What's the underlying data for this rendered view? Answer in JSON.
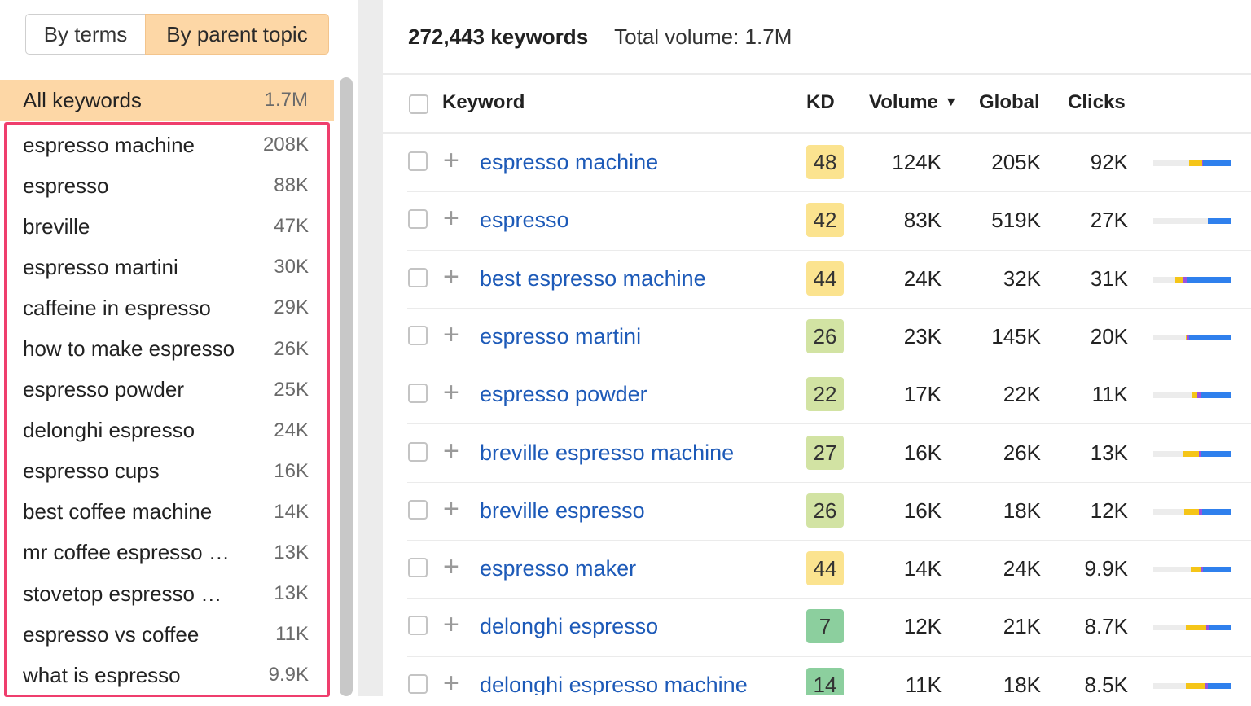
{
  "toggle": {
    "by_terms": "By terms",
    "by_parent_topic": "By parent topic"
  },
  "all_keywords": {
    "label": "All keywords",
    "volume": "1.7M"
  },
  "topics": [
    {
      "name": "espresso machine",
      "volume": "208K"
    },
    {
      "name": "espresso",
      "volume": "88K"
    },
    {
      "name": "breville",
      "volume": "47K"
    },
    {
      "name": "espresso martini",
      "volume": "30K"
    },
    {
      "name": "caffeine in espresso",
      "volume": "29K"
    },
    {
      "name": "how to make espresso",
      "volume": "26K"
    },
    {
      "name": "espresso powder",
      "volume": "25K"
    },
    {
      "name": "delonghi espresso",
      "volume": "24K"
    },
    {
      "name": "espresso cups",
      "volume": "16K"
    },
    {
      "name": "best coffee machine",
      "volume": "14K"
    },
    {
      "name": "mr coffee espresso …",
      "volume": "13K"
    },
    {
      "name": "stovetop espresso …",
      "volume": "13K"
    },
    {
      "name": "espresso vs coffee",
      "volume": "11K"
    },
    {
      "name": "what is espresso",
      "volume": "9.9K"
    }
  ],
  "header": {
    "count": "272,443 keywords",
    "total_volume": "Total volume: 1.7M"
  },
  "columns": {
    "keyword": "Keyword",
    "kd": "KD",
    "volume": "Volume",
    "global": "Global",
    "clicks": "Clicks"
  },
  "colors": {
    "kd_yellow": "#fbe38f",
    "kd_lightgreen": "#d2e3a3",
    "kd_green": "#8ccf9e",
    "accent": "#fdd7a6",
    "highlight_border": "#ef3e6d",
    "link": "#1d5ab8"
  },
  "rows": [
    {
      "keyword": "espresso machine",
      "kd": "48",
      "kd_color": "#fbe38f",
      "volume": "124K",
      "global": "205K",
      "clicks": "92K",
      "click_split": [
        0.46,
        0.16,
        0.02,
        0.36
      ]
    },
    {
      "keyword": "espresso",
      "kd": "42",
      "kd_color": "#fbe38f",
      "volume": "83K",
      "global": "519K",
      "clicks": "27K",
      "click_split": [
        0.7,
        0,
        0,
        0.3
      ]
    },
    {
      "keyword": "best espresso machine",
      "kd": "44",
      "kd_color": "#fbe38f",
      "volume": "24K",
      "global": "32K",
      "clicks": "31K",
      "click_split": [
        0.28,
        0.1,
        0.06,
        0.56
      ]
    },
    {
      "keyword": "espresso martini",
      "kd": "26",
      "kd_color": "#d2e3a3",
      "volume": "23K",
      "global": "145K",
      "clicks": "20K",
      "click_split": [
        0.42,
        0.02,
        0.02,
        0.54
      ]
    },
    {
      "keyword": "espresso powder",
      "kd": "22",
      "kd_color": "#d2e3a3",
      "volume": "17K",
      "global": "22K",
      "clicks": "11K",
      "click_split": [
        0.5,
        0.06,
        0.04,
        0.4
      ]
    },
    {
      "keyword": "breville espresso machine",
      "kd": "27",
      "kd_color": "#d2e3a3",
      "volume": "16K",
      "global": "26K",
      "clicks": "13K",
      "click_split": [
        0.38,
        0.2,
        0.02,
        0.4
      ]
    },
    {
      "keyword": "breville espresso",
      "kd": "26",
      "kd_color": "#d2e3a3",
      "volume": "16K",
      "global": "18K",
      "clicks": "12K",
      "click_split": [
        0.4,
        0.18,
        0.04,
        0.38
      ]
    },
    {
      "keyword": "espresso maker",
      "kd": "44",
      "kd_color": "#fbe38f",
      "volume": "14K",
      "global": "24K",
      "clicks": "9.9K",
      "click_split": [
        0.48,
        0.12,
        0.04,
        0.36
      ]
    },
    {
      "keyword": "delonghi espresso",
      "kd": "7",
      "kd_color": "#8ccf9e",
      "volume": "12K",
      "global": "21K",
      "clicks": "8.7K",
      "click_split": [
        0.42,
        0.26,
        0.04,
        0.28
      ]
    },
    {
      "keyword": "delonghi espresso machine",
      "kd": "14",
      "kd_color": "#8ccf9e",
      "volume": "11K",
      "global": "18K",
      "clicks": "8.5K",
      "click_split": [
        0.42,
        0.24,
        0.04,
        0.3
      ]
    }
  ]
}
